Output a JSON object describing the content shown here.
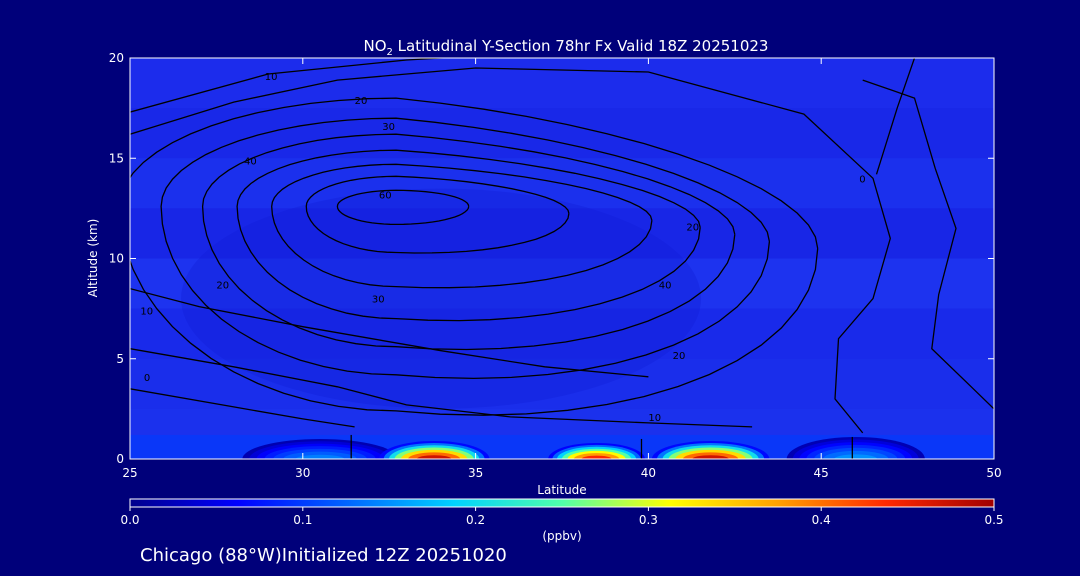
{
  "chart_data": {
    "type": "heatmap",
    "title_parts": {
      "species": "NO",
      "subscript": "2",
      "rest": " Latitudinal Y-Section 78hr  Fx Valid 18Z 20251023"
    },
    "xlabel": "Latitude",
    "ylabel": "Altitude (km)",
    "xlim": [
      25,
      50
    ],
    "ylim": [
      0,
      20
    ],
    "x_ticks": [
      25,
      30,
      35,
      40,
      45,
      50
    ],
    "y_ticks": [
      0,
      5,
      10,
      15,
      20
    ],
    "colorbar": {
      "unit": "(ppbv)",
      "range": [
        0.0,
        0.5
      ],
      "tick_labels": [
        "0.0",
        "0.1",
        "0.2",
        "0.3",
        "0.4",
        "0.5"
      ],
      "colors": [
        "#00008c",
        "#0000ff",
        "#0064ff",
        "#00d2ff",
        "#50ffaa",
        "#ffff00",
        "#ffa000",
        "#ff2800",
        "#a00000"
      ]
    },
    "background_level": 0.04,
    "surface_plumes": [
      {
        "center_lat": 33.8,
        "width_lat": 3.2,
        "height_km": 0.9,
        "peak": 0.47
      },
      {
        "center_lat": 38.5,
        "width_lat": 2.8,
        "height_km": 0.8,
        "peak": 0.44
      },
      {
        "center_lat": 41.8,
        "width_lat": 3.4,
        "height_km": 0.9,
        "peak": 0.47
      },
      {
        "center_lat": 30.5,
        "width_lat": 4.5,
        "height_km": 1.0,
        "peak": 0.14
      },
      {
        "center_lat": 46.0,
        "width_lat": 4.0,
        "height_km": 1.1,
        "peak": 0.15
      }
    ],
    "overlay_contours": {
      "levels": [
        0,
        10,
        20,
        30,
        40,
        50,
        60
      ],
      "center": {
        "lat": 32.7,
        "alt_km": 12.6
      },
      "labels": [
        {
          "text": "10",
          "lat": 28.9,
          "alt_km": 18.9
        },
        {
          "text": "20",
          "lat": 31.5,
          "alt_km": 17.7
        },
        {
          "text": "30",
          "lat": 32.3,
          "alt_km": 16.4
        },
        {
          "text": "40",
          "lat": 28.3,
          "alt_km": 14.7
        },
        {
          "text": "60",
          "lat": 32.2,
          "alt_km": 13.0
        },
        {
          "text": "20",
          "lat": 41.1,
          "alt_km": 11.4
        },
        {
          "text": "40",
          "lat": 40.3,
          "alt_km": 8.5
        },
        {
          "text": "30",
          "lat": 32.0,
          "alt_km": 7.8
        },
        {
          "text": "20",
          "lat": 27.5,
          "alt_km": 8.5
        },
        {
          "text": "20",
          "lat": 40.7,
          "alt_km": 5.0
        },
        {
          "text": "10",
          "lat": 25.3,
          "alt_km": 7.2
        },
        {
          "text": "0",
          "lat": 25.4,
          "alt_km": 3.9
        },
        {
          "text": "10",
          "lat": 40.0,
          "alt_km": 1.9
        },
        {
          "text": "0",
          "lat": 46.1,
          "alt_km": 13.8
        }
      ]
    }
  },
  "footer": {
    "location": "Chicago (88°W)Initialized 12Z 20251020"
  }
}
